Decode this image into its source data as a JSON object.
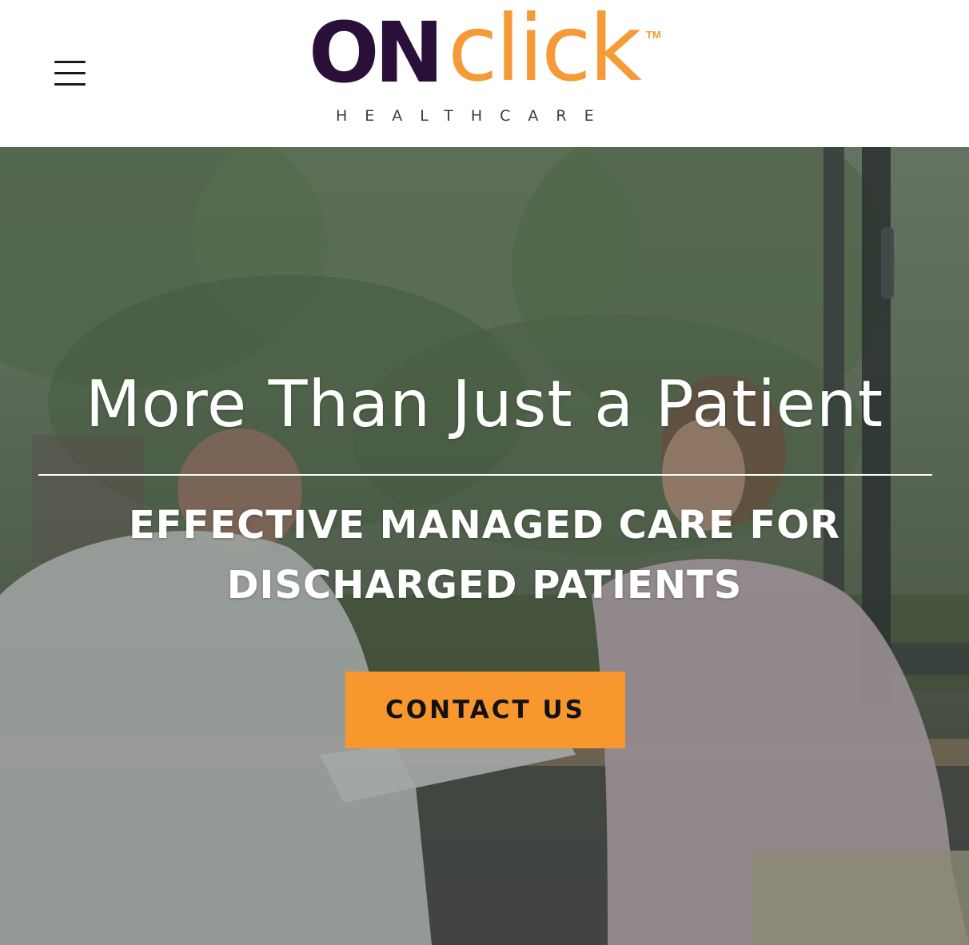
{
  "header": {
    "menu_icon": "hamburger-menu-icon",
    "logo": {
      "on": "ON",
      "click": "click",
      "trademark": "TM",
      "tagline": "HEALTHCARE",
      "colors": {
        "on": "#2a1038",
        "click": "#f59a37",
        "tagline": "#3c3c3c"
      }
    }
  },
  "hero": {
    "headline": "More Than Just a Patient",
    "subheadline": "EFFECTIVE MANAGED CARE FOR DISCHARGED PATIENTS",
    "cta_label": "CONTACT US",
    "colors": {
      "cta_background": "#f8972d",
      "text": "#ffffff"
    }
  }
}
